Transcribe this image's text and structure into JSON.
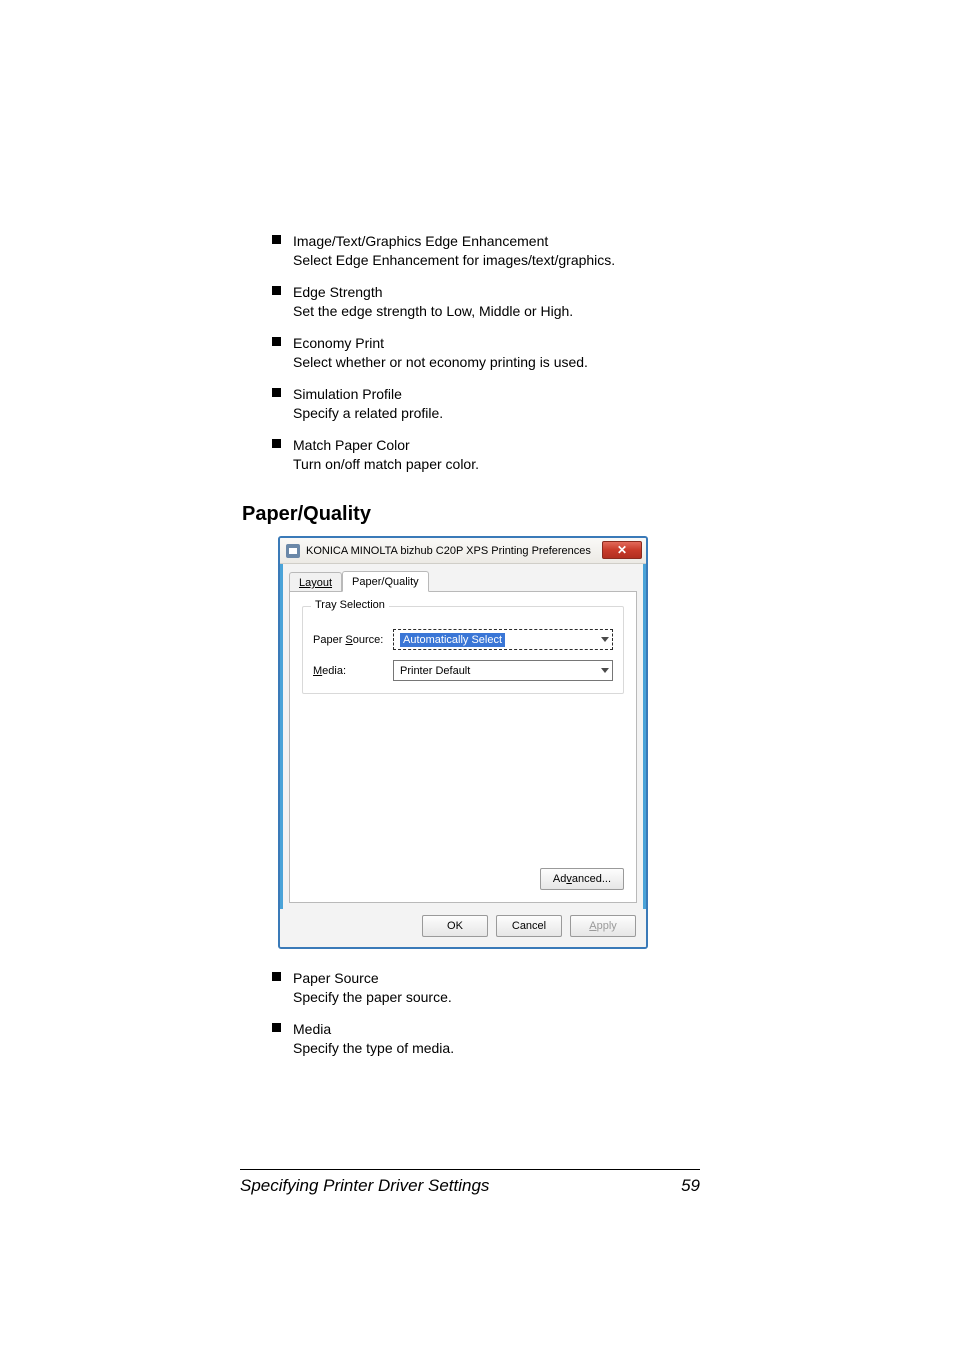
{
  "bullets_top": [
    {
      "title": "Image/Text/Graphics Edge Enhancement",
      "desc": "Select Edge Enhancement for images/text/graphics."
    },
    {
      "title": "Edge Strength",
      "desc": "Set the edge strength to Low, Middle or High."
    },
    {
      "title": "Economy Print",
      "desc": "Select whether or not economy printing is used."
    },
    {
      "title": "Simulation Profile",
      "desc": "Specify a related profile."
    },
    {
      "title": "Match Paper Color",
      "desc": "Turn on/off match paper color."
    }
  ],
  "section_heading": "Paper/Quality",
  "dialog": {
    "title": "KONICA MINOLTA bizhub C20P XPS Printing Preferences",
    "close_glyph": "✕",
    "tabs": {
      "layout": "Layout",
      "paper_quality": "Paper/Quality"
    },
    "group_label": "Tray Selection",
    "rows": {
      "paper_source_label_pre": "Paper ",
      "paper_source_label_u": "S",
      "paper_source_label_post": "ource:",
      "paper_source_value": "Automatically Select",
      "media_label_u": "M",
      "media_label_post": "edia:",
      "media_value": "Printer Default"
    },
    "buttons": {
      "advanced_pre": "Ad",
      "advanced_u": "v",
      "advanced_post": "anced...",
      "ok": "OK",
      "cancel": "Cancel",
      "apply_u": "A",
      "apply_post": "pply"
    }
  },
  "bullets_bottom": [
    {
      "title": "Paper Source",
      "desc": "Specify the paper source."
    },
    {
      "title": "Media",
      "desc": "Specify the type of media."
    }
  ],
  "footer": {
    "left": "Specifying Printer Driver Settings",
    "right": "59"
  }
}
